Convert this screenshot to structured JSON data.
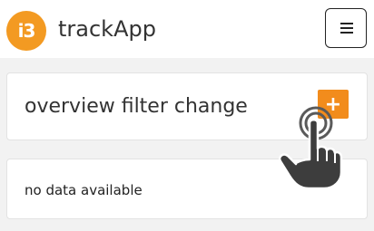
{
  "app": {
    "logo_text": "i3",
    "name": "trackApp"
  },
  "header": {
    "menu_icon": "hamburger-menu-icon"
  },
  "filter_card": {
    "title": "overview filter change",
    "add_label": "+"
  },
  "data_card": {
    "message": "no data available"
  },
  "overlay": {
    "icon": "tap-gesture-icon"
  },
  "colors": {
    "brand": "#f39a22",
    "accent": "#f28c1c",
    "background": "#f2f2f2"
  }
}
